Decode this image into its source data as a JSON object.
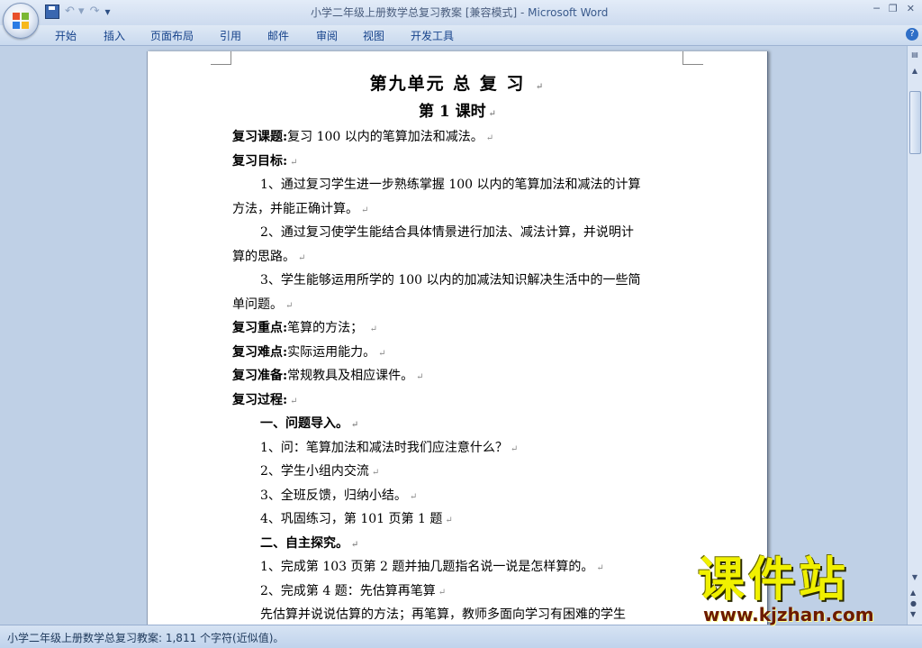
{
  "window": {
    "doc_name": "小学二年级上册数学总复习教案 [兼容模式]",
    "separator": " - ",
    "app_name": "Microsoft Word",
    "minimize_glyph": "─",
    "restore_glyph": "❐",
    "close_glyph": "✕"
  },
  "quick_access": {
    "undo_glyph": "↶ ▾",
    "redo_glyph": "↷",
    "customize_glyph": "▾"
  },
  "ribbon_tabs": [
    "开始",
    "插入",
    "页面布局",
    "引用",
    "邮件",
    "审阅",
    "视图",
    "开发工具"
  ],
  "help_glyph": "?",
  "paragraph_mark": "↵",
  "document": {
    "title": "第九单元    总  复  习 ",
    "subtitle": "第 1 课时",
    "topic_label": "复习课题:",
    "topic_text": "复习 100 以内的笔算加法和减法。",
    "goals_label": "复习目标:",
    "goal1_line1": "1、通过复习学生进一步熟练掌握 100 以内的笔算加法和减法的计算",
    "goal1_line2": "方法，并能正确计算。",
    "goal2_line1": "2、通过复习使学生能结合具体情景进行加法、减法计算，并说明计",
    "goal2_line2": "算的思路。",
    "goal3_line1": "3、学生能够运用所学的 100 以内的加减法知识解决生活中的一些简",
    "goal3_line2": "单问题。",
    "key_label": "复习重点:",
    "key_text": "笔算的方法；  ",
    "difficulty_label": "复习难点:",
    "difficulty_text": "实际运用能力。",
    "prep_label": "复习准备:",
    "prep_text": "常规教具及相应课件。",
    "process_label": "复习过程:",
    "sec1_title": "一、问题导入。",
    "sec1_item1": "1、问：笔算加法和减法时我们应注意什么？",
    "sec1_item2": "2、学生小组内交流",
    "sec1_item3": "3、全班反馈，归纳小结。",
    "sec1_item4": "4、巩固练习，第 101 页第 1 题",
    "sec2_title": "二、自主探究。",
    "sec2_item1": "1、完成第 103 页第 2 题并抽几题指名说一说是怎样算的。",
    "sec2_item2": "2、完成第 4 题：先估算再笔算",
    "sec2_item3": "先估算并说说估算的方法；再笔算，教师多面向学习有困难的学生"
  },
  "status_bar": {
    "text": "小学二年级上册数学总复习教案: 1,811 个字符(近似值)。"
  },
  "watermark": {
    "big": "课件站",
    "url": "www.kjzhan.com"
  },
  "colors": {
    "ribbon_text": "#15428b",
    "page": "#ffffff",
    "workspace": "#bfd0e6",
    "watermark_yellow": "#f0f000"
  }
}
